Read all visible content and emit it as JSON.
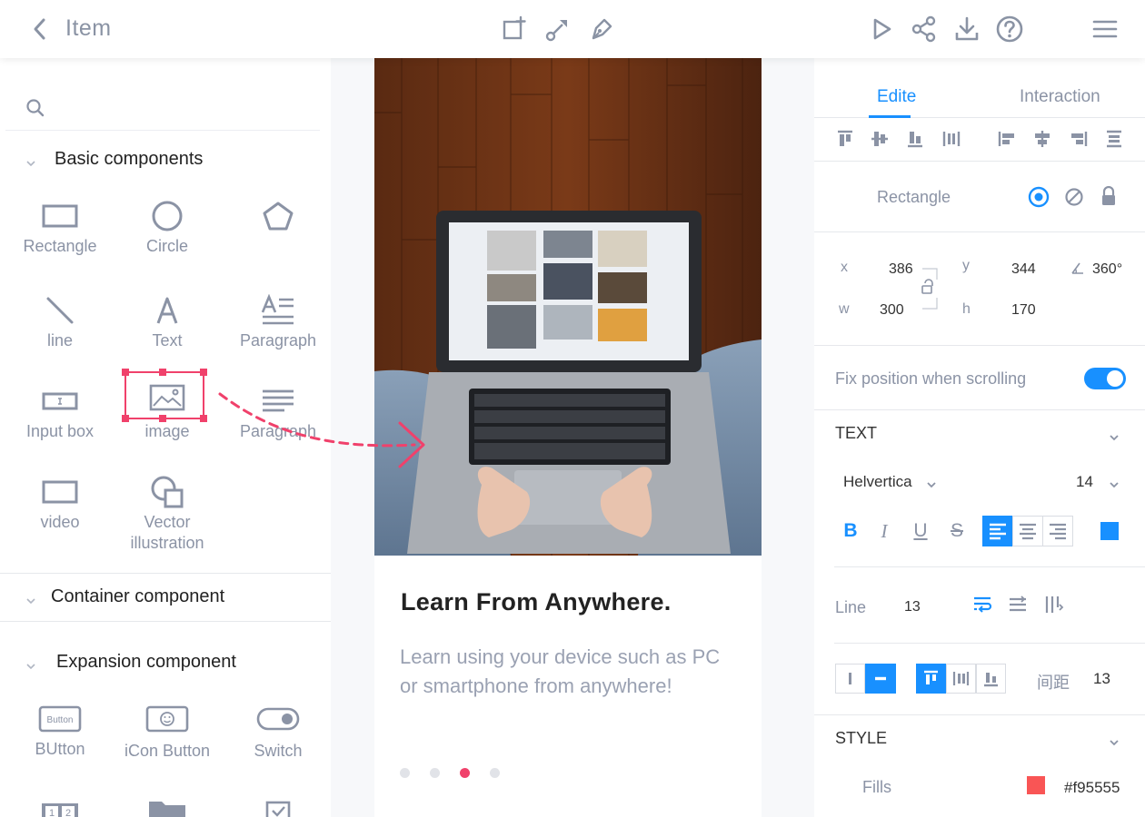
{
  "header": {
    "title": "Item",
    "icons": [
      "back-icon",
      "add-page-icon",
      "path-node-icon",
      "pen-tool-icon",
      "play-icon",
      "share-icon",
      "download-icon",
      "help-icon",
      "menu-icon"
    ]
  },
  "left_panel": {
    "search": {
      "placeholder": ""
    },
    "sections": {
      "basic": "Basic components",
      "container": "Container component",
      "expansion": "Expansion component"
    },
    "basic_items": [
      "Rectangle",
      "Circle",
      "line",
      "Text",
      "Paragraph",
      "Input box",
      "image",
      "Paragraph",
      "video",
      "Vector illustration"
    ],
    "vector_line1": "Vector",
    "vector_line2": "illustration",
    "expansion_items": [
      "BUtton",
      "iCon Button",
      "Switch"
    ],
    "button_icon_text": "Button",
    "pager_icon_text": [
      "1",
      "2"
    ]
  },
  "canvas": {
    "card": {
      "title": "Learn From Anywhere.",
      "body": "Learn using your device such as PC or smartphone from anywhere!"
    },
    "carousel": {
      "count": 4,
      "active_index": 2
    }
  },
  "right_panel": {
    "tabs": [
      "Edite",
      "Interaction"
    ],
    "active_tab": "Edite",
    "layer": {
      "name": "Rectangle"
    },
    "geometry": {
      "x_label": "x",
      "x": "386",
      "y_label": "y",
      "y": "344",
      "w_label": "w",
      "w": "300",
      "h_label": "h",
      "h": "170",
      "rotation": "360°"
    },
    "fix_position": {
      "label": "Fix position when scrolling",
      "enabled": true
    },
    "text_section": {
      "header": "TEXT",
      "font": "Helvertica",
      "size": "14",
      "format_buttons": [
        "B",
        "I",
        "U",
        "S"
      ],
      "color": "#1890ff",
      "line_label": "Line",
      "line_value": "13",
      "spacing_label": "间距",
      "spacing_value": "13"
    },
    "style_section": {
      "header": "STYLE",
      "fills_label": "Fills",
      "fill_hex": "#f95555",
      "fill_color": "#f95555"
    }
  },
  "colors": {
    "accent": "#1890ff",
    "highlight": "#f0416b",
    "muted_text": "#8b93a5"
  }
}
